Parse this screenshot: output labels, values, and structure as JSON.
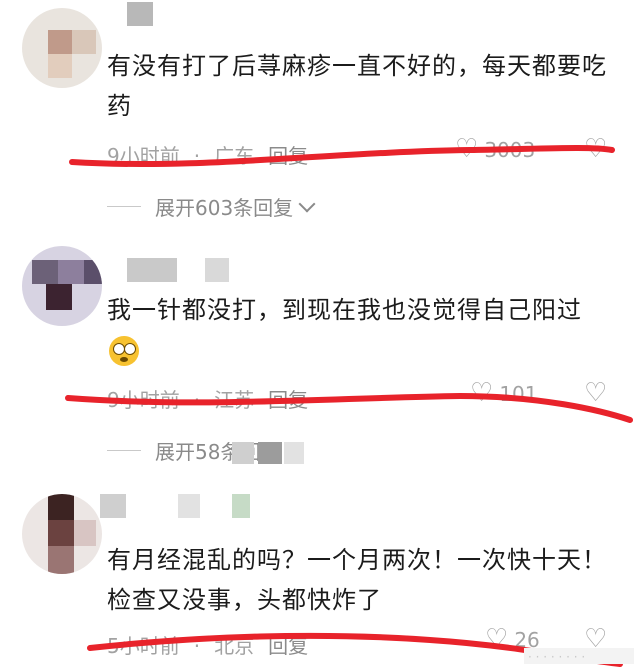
{
  "comments": [
    {
      "text": "有没有打了后荨麻疹一直不好的，每天都要吃药",
      "time": "9小时前",
      "location": "广东",
      "reply_label": "回复",
      "likes": "3003",
      "expand_label": "展开603条回复"
    },
    {
      "text": "我一针都没打，到现在我也没觉得自己阳过",
      "emoji": "eye-roll-emoji",
      "time": "9小时前",
      "location": "江苏",
      "reply_label": "回复",
      "likes": "101",
      "expand_label": "展开58条回复"
    },
    {
      "text": "有月经混乱的吗？一个月两次！一次快十天！检查又没事，头都快炸了",
      "time": "5小时前",
      "location": "北京",
      "reply_label": "回复",
      "likes": "26"
    }
  ],
  "separator": "·",
  "annotation_color": "#e8232b",
  "icons": {
    "like": "heart-icon",
    "dislike": "broken-heart-icon",
    "expand": "chevron-down-icon"
  }
}
